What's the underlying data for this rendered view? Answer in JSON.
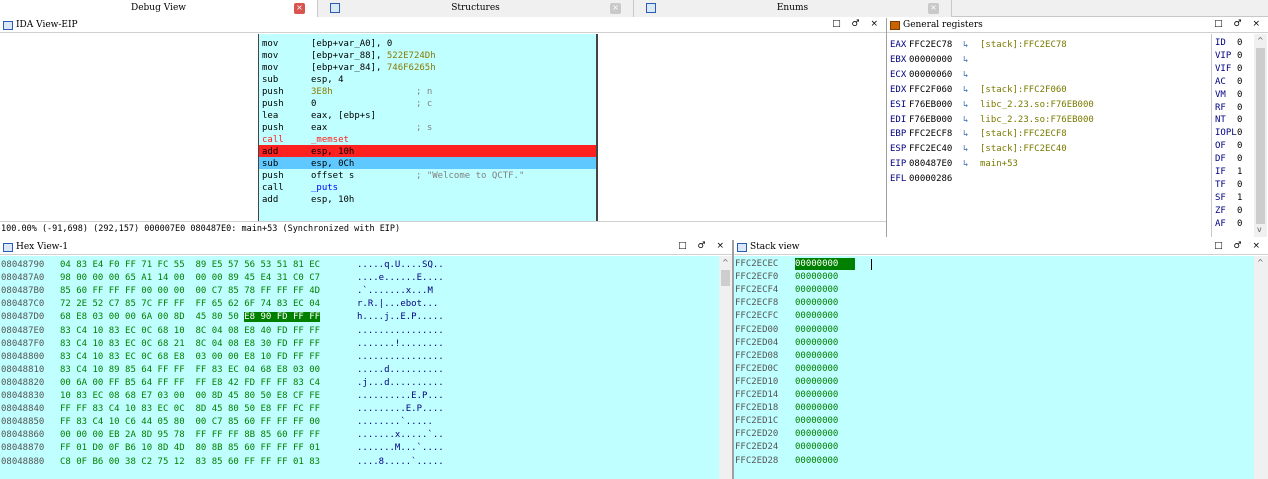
{
  "tabs": [
    {
      "label": "Debug View",
      "close": "×"
    },
    {
      "label": "Structures",
      "close": "×"
    },
    {
      "label": "Enums",
      "close": "×"
    }
  ],
  "ida_view": {
    "title": "IDA View-EIP",
    "controls": "□ ♂ ×",
    "lines": [
      {
        "mn": "mov",
        "op": "[ebp+var_A0], 0",
        "cm": ""
      },
      {
        "mn": "mov",
        "op": "[ebp+var_88], ",
        "num": "522E724Dh",
        "cm": ""
      },
      {
        "mn": "mov",
        "op": "[ebp+var_84], ",
        "num": "746F6265h",
        "cm": ""
      },
      {
        "mn": "sub",
        "op": "esp, 4",
        "cm": ""
      },
      {
        "mn": "push",
        "op": "",
        "num": "3E8h",
        "cm": "; n"
      },
      {
        "mn": "push",
        "op": "0",
        "cm": "; c"
      },
      {
        "mn": "lea",
        "op": "eax, [ebp+s]",
        "cm": ""
      },
      {
        "mn": "push",
        "op": "eax",
        "cm": "; s"
      },
      {
        "mn": "call",
        "op": "_memset",
        "cm": ""
      },
      {
        "mn": "add",
        "op": "esp, 10h",
        "cm": ""
      },
      {
        "mn": "sub",
        "op": "esp, 0Ch",
        "cm": ""
      },
      {
        "mn": "push",
        "op": "offset s",
        "cm": "; \"Welcome to QCTF.\""
      },
      {
        "mn": "call",
        "op": "",
        "sym": "_puts",
        "cm": ""
      },
      {
        "mn": "add",
        "op": "esp, 10h",
        "cm": ""
      }
    ],
    "status": "100.00% (-91,698) (292,157) 000007E0 080487E0: main+53 (Synchronized with EIP)"
  },
  "registers": {
    "title": "General registers",
    "controls": "□ ♂ ×",
    "rows": [
      {
        "name": "EAX",
        "value": "FFC2EC78",
        "arrow": "↳",
        "target": "[stack]:FFC2EC78"
      },
      {
        "name": "EBX",
        "value": "00000000",
        "arrow": "↳",
        "target": ""
      },
      {
        "name": "ECX",
        "value": "00000060",
        "arrow": "↳",
        "target": ""
      },
      {
        "name": "EDX",
        "value": "FFC2F060",
        "arrow": "↳",
        "target": "[stack]:FFC2F060"
      },
      {
        "name": "ESI",
        "value": "F76EB000",
        "arrow": "↳",
        "target": "libc_2.23.so:F76EB000"
      },
      {
        "name": "EDI",
        "value": "F76EB000",
        "arrow": "↳",
        "target": "libc_2.23.so:F76EB000"
      },
      {
        "name": "EBP",
        "value": "FFC2ECF8",
        "arrow": "↳",
        "target": "[stack]:FFC2ECF8"
      },
      {
        "name": "ESP",
        "value": "FFC2EC40",
        "arrow": "↳",
        "target": "[stack]:FFC2EC40"
      },
      {
        "name": "EIP",
        "value": "080487E0",
        "arrow": "↳",
        "target": "main+53"
      },
      {
        "name": "EFL",
        "value": "00000286",
        "arrow": "",
        "target": ""
      }
    ],
    "flags": [
      {
        "name": "ID",
        "value": "0"
      },
      {
        "name": "VIP",
        "value": "0"
      },
      {
        "name": "VIF",
        "value": "0"
      },
      {
        "name": "AC",
        "value": "0"
      },
      {
        "name": "VM",
        "value": "0"
      },
      {
        "name": "RF",
        "value": "0"
      },
      {
        "name": "NT",
        "value": "0"
      },
      {
        "name": "IOPL",
        "value": "0"
      },
      {
        "name": "OF",
        "value": "0"
      },
      {
        "name": "DF",
        "value": "0"
      },
      {
        "name": "IF",
        "value": "1"
      },
      {
        "name": "TF",
        "value": "0"
      },
      {
        "name": "SF",
        "value": "1"
      },
      {
        "name": "ZF",
        "value": "0"
      },
      {
        "name": "AF",
        "value": "0"
      }
    ]
  },
  "hex_view": {
    "title": "Hex View-1",
    "controls": "□ ♂ ×",
    "highlight_bytes": "E8 90 FD FF FF",
    "rows": [
      {
        "addr": "08048790",
        "hex": "04 83 E4 F0 FF 71 FC 55  89 E5 57 56 53 51 81 EC",
        "ascii": ".....q.U....SQ.."
      },
      {
        "addr": "080487A0",
        "hex": "98 00 00 00 65 A1 14 00  00 00 89 45 E4 31 C0 C7",
        "ascii": "....e......E...."
      },
      {
        "addr": "080487B0",
        "hex": "85 60 FF FF FF 00 00 00  00 C7 85 78 FF FF FF 4D",
        "ascii": ".`.......x...M"
      },
      {
        "addr": "080487C0",
        "hex": "72 2E 52 C7 85 7C FF FF  FF 65 62 6F 74 83 EC 04",
        "ascii": "r.R.|...ebot..."
      },
      {
        "addr": "080487D0",
        "hex": "68 E8 03 00 00 6A 00 8D  45 80 50 ",
        "hexhl": "E8 90 FD FF FF",
        "ascii": "h....j..E.P....."
      },
      {
        "addr": "080487E0",
        "hex": "83 C4 10 83 EC 0C 68 10  8C 04 08 E8 40 FD FF FF",
        "ascii": "................"
      },
      {
        "addr": "080487F0",
        "hex": "83 C4 10 83 EC 0C 68 21  8C 04 08 E8 30 FD FF FF",
        "ascii": ".......!........"
      },
      {
        "addr": "08048800",
        "hex": "83 C4 10 83 EC 0C 68 E8  03 00 00 E8 10 FD FF FF",
        "ascii": "................"
      },
      {
        "addr": "08048810",
        "hex": "83 C4 10 89 85 64 FF FF  FF 83 EC 04 68 E8 03 00",
        "ascii": ".....d.........."
      },
      {
        "addr": "08048820",
        "hex": "00 6A 00 FF B5 64 FF FF  FF E8 42 FD FF FF 83 C4",
        "ascii": ".j...d.........."
      },
      {
        "addr": "08048830",
        "hex": "10 83 EC 08 68 E7 03 00  00 8D 45 80 50 E8 CF FE",
        "ascii": "..........E.P..."
      },
      {
        "addr": "08048840",
        "hex": "FF FF 83 C4 10 83 EC 0C  8D 45 80 50 E8 FF FC FF",
        "ascii": ".........E.P...."
      },
      {
        "addr": "08048850",
        "hex": "FF 83 C4 10 C6 44 05 80  00 C7 85 60 FF FF FF 00",
        "ascii": "........`....."
      },
      {
        "addr": "08048860",
        "hex": "00 00 00 EB 2A 8D 95 78  FF FF FF 8B 85 60 FF FF",
        "ascii": ".......x.....`.."
      },
      {
        "addr": "08048870",
        "hex": "FF 01 D0 0F B6 10 8D 4D  80 8B 85 60 FF FF FF 01",
        "ascii": ".......M...`...."
      },
      {
        "addr": "08048880",
        "hex": "C8 0F B6 00 38 C2 75 12  83 85 60 FF FF FF 01 83",
        "ascii": "....8.....`....."
      }
    ]
  },
  "stack_view": {
    "title": "Stack view",
    "controls": "□ ♂ ×",
    "rows": [
      {
        "addr": "FFC2ECEC",
        "val": "00000000"
      },
      {
        "addr": "FFC2ECF0",
        "val": "00000000"
      },
      {
        "addr": "FFC2ECF4",
        "val": "00000000"
      },
      {
        "addr": "FFC2ECF8",
        "val": "00000000"
      },
      {
        "addr": "FFC2ECFC",
        "val": "00000000"
      },
      {
        "addr": "FFC2ED00",
        "val": "00000000"
      },
      {
        "addr": "FFC2ED04",
        "val": "00000000"
      },
      {
        "addr": "FFC2ED08",
        "val": "00000000"
      },
      {
        "addr": "FFC2ED0C",
        "val": "00000000"
      },
      {
        "addr": "FFC2ED10",
        "val": "00000000"
      },
      {
        "addr": "FFC2ED14",
        "val": "00000000"
      },
      {
        "addr": "FFC2ED18",
        "val": "00000000"
      },
      {
        "addr": "FFC2ED1C",
        "val": "00000000"
      },
      {
        "addr": "FFC2ED20",
        "val": "00000000"
      },
      {
        "addr": "FFC2ED24",
        "val": "00000000"
      },
      {
        "addr": "FFC2ED28",
        "val": "00000000"
      }
    ]
  },
  "colors": {
    "cyan_bg": "#c0ffff",
    "call_highlight": "#ff2020",
    "current_line": "#5fc8ff",
    "hex_highlight": "#008000"
  }
}
